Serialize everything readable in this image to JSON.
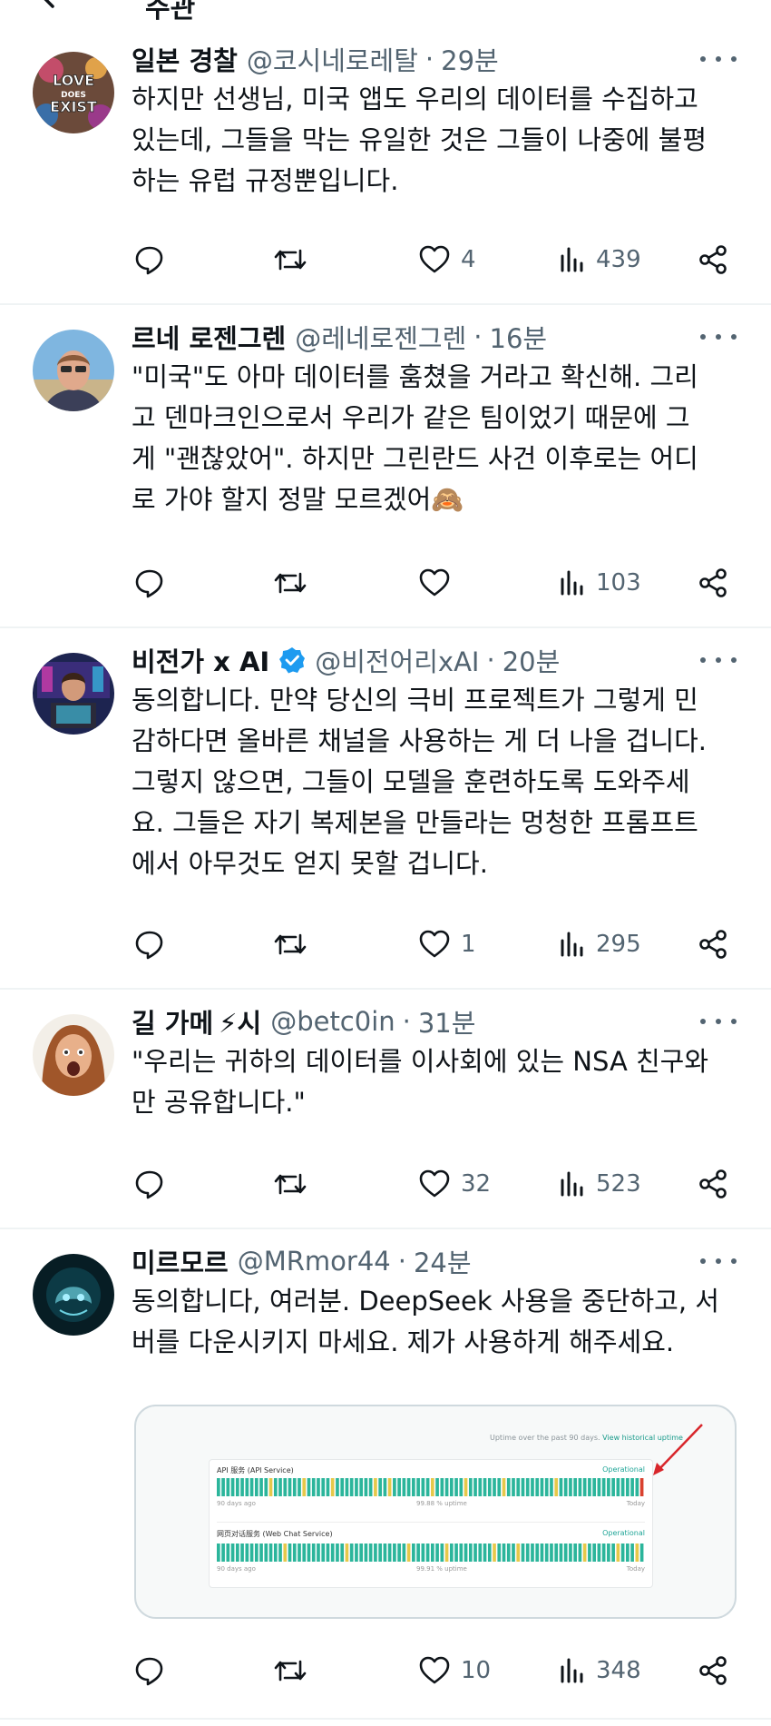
{
  "header": {
    "title": "주관"
  },
  "colors": {
    "accent": "#1d9bf0",
    "muted": "#536471",
    "operational": "#1fa597",
    "bar_green": "#2bb59b",
    "bar_yellow": "#e6c84a",
    "bar_red": "#d9412f",
    "arrow_red": "#d8262b"
  },
  "tweets": [
    {
      "name": "일본 경찰",
      "handle": "@코시네로레탈",
      "time": "29분",
      "lines": [
        "하지만 선생님, 미국 앱도 우리의 데이터를 수집하고",
        "있는데, 그들을 막는 유일한 것은 그들이 나중에 불평",
        "하는 유럽 규정뿐입니다."
      ],
      "likes": "4",
      "views": "439",
      "avatar_text": [
        "LOVE",
        "DOES",
        "EXIST"
      ]
    },
    {
      "name": "르네 로젠그렌",
      "handle": "@레네로젠그렌",
      "time": "16분",
      "lines": [
        "\"미국\"도 아마 데이터를 훔쳤을 거라고 확신해. 그리",
        "고 덴마크인으로서 우리가 같은 팀이었기 때문에 그",
        "게 \"괜찮았어\". 하지만 그린란드 사건 이후로는 어디",
        "로 가야 할지 정말 모르겠어🙈"
      ],
      "likes": "",
      "views": "103"
    },
    {
      "name": "비전가 x AI",
      "handle": "@비전어리xAI",
      "time": "20분",
      "verified": true,
      "lines": [
        "동의합니다. 만약 당신의 극비 프로젝트가 그렇게 민",
        "감하다면 올바른 채널을 사용하는 게 더 나을 겁니다.",
        "그렇지 않으면, 그들이 모델을 훈련하도록 도와주세",
        "요. 그들은 자기 복제본을 만들라는 멍청한 프롬프트",
        "에서 아무것도 얻지 못할 겁니다."
      ],
      "likes": "1",
      "views": "295"
    },
    {
      "name": "길 가메",
      "name_suffix": "⚡시",
      "handle": "@betc0in",
      "time": "31분",
      "lines": [
        "\"우리는 귀하의 데이터를 이사회에 있는 NSA 친구와",
        "만 공유합니다.\""
      ],
      "likes": "32",
      "views": "523"
    },
    {
      "name": "미르모르",
      "handle": "@MRmor44",
      "time": "24분",
      "lines": [
        "동의합니다, 여러분. DeepSeek 사용을 중단하고, 서",
        "버를 다운시키지 마세요. 제가 사용하게 해주세요."
      ],
      "likes": "10",
      "views": "348"
    }
  ],
  "media": {
    "uptime_note": "Uptime over the past 90 days.",
    "uptime_link": "View historical uptime",
    "services": [
      {
        "label": "API 服务 (API Service)",
        "status": "Operational",
        "left": "90 days ago",
        "center": "99.88 % uptime",
        "right": "Today"
      },
      {
        "label": "网页对话服务 (Web Chat Service)",
        "status": "Operational",
        "left": "90 days ago",
        "center": "99.91 % uptime",
        "right": "Today"
      }
    ]
  }
}
